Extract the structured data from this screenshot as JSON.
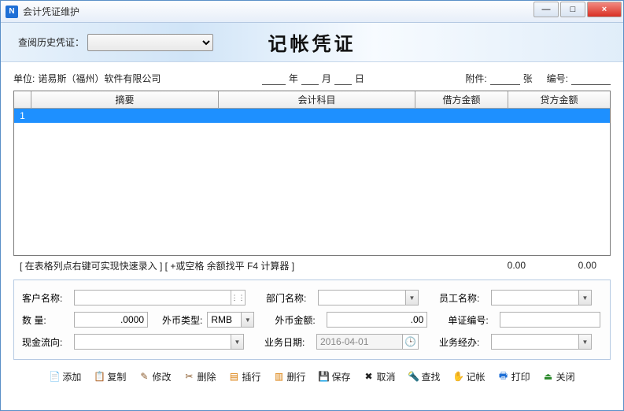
{
  "window": {
    "title": "会计凭证维护"
  },
  "banner": {
    "history_label": "查阅历史凭证：",
    "page_title": "记帐凭证"
  },
  "header": {
    "unit_label": "单位:",
    "unit_value": "诺易斯（福州）软件有限公司",
    "date_year": "年",
    "date_month": "月",
    "date_day": "日",
    "attach_label": "附件:",
    "attach_unit": "张",
    "number_label": "编号:"
  },
  "table": {
    "cols": {
      "summary": "摘要",
      "subject": "会计科目",
      "debit": "借方金额",
      "credit": "贷方金额"
    },
    "rows": [
      {
        "n": "1",
        "summary": "",
        "subject": "",
        "debit": "",
        "credit": ""
      }
    ],
    "hint": "[ 在表格列点右键可实现快速录入 ] [ +或空格 余额找平  F4 计算器  ]",
    "total_debit": "0.00",
    "total_credit": "0.00"
  },
  "form": {
    "customer_label": "客户名称:",
    "dept_label": "部门名称:",
    "emp_label": "员工名称:",
    "qty_label": "数    量:",
    "qty_value": ".0000",
    "currency_type_label": "外币类型:",
    "currency_type_value": "RMB",
    "fc_amount_label": "外币金额:",
    "fc_amount_value": ".00",
    "docno_label": "单证编号:",
    "cashflow_label": "现金流向:",
    "bizdate_label": "业务日期:",
    "bizdate_value": "2016-04-01",
    "operator_label": "业务经办:"
  },
  "toolbar": {
    "add": "添加",
    "copy": "复制",
    "edit": "修改",
    "delete": "删除",
    "insert": "插行",
    "delrow": "删行",
    "save": "保存",
    "cancel": "取消",
    "find": "查找",
    "book": "记帐",
    "print": "打印",
    "close": "关闭"
  }
}
